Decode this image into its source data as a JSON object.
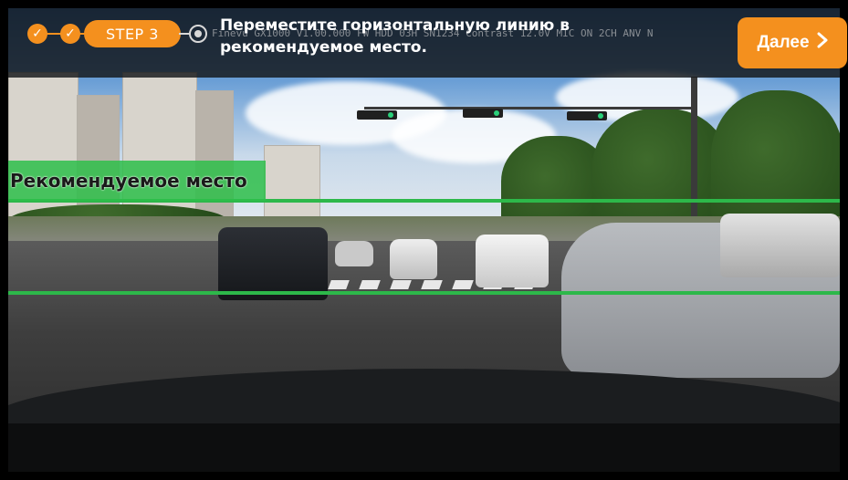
{
  "stepper": {
    "completed_steps": [
      "check-icon",
      "check-icon"
    ],
    "current_step_label": "STEP 3",
    "next_step_icon": "circle-radio-icon"
  },
  "instruction_text": "Переместите горизонтальную линию в рекомендуемое место.",
  "osd_overlay_text": "Finevu GX1000 V1.00.000  FW HDD 03H  SN1234  Contrast 12.0V  MIC ON  2CH  ANV N",
  "next_button": {
    "label": "Далее",
    "icon": "chevron-right-icon"
  },
  "recommended_zone_label": "Рекомендуемое место",
  "colors": {
    "accent_orange": "#f4901e",
    "guide_green": "#2db84a",
    "topbar_bg": "#141619"
  }
}
